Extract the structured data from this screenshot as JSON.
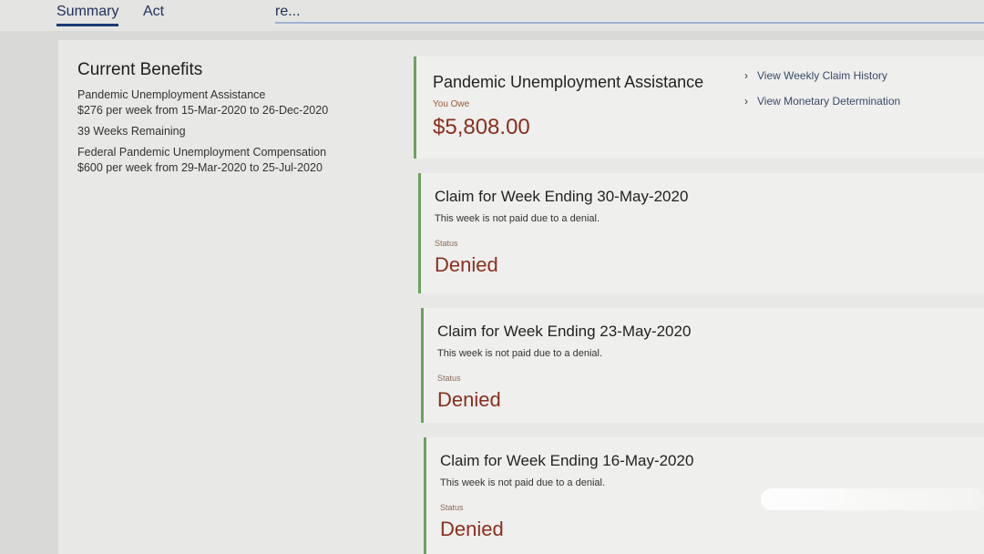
{
  "tabs": {
    "summary": "Summary",
    "activity": "Act",
    "more": "re..."
  },
  "current_benefits": {
    "title": "Current Benefits",
    "lines": [
      "Pandemic Unemployment Assistance",
      "$276 per week from 15-Mar-2020 to 26-Dec-2020",
      "39 Weeks Remaining",
      "Federal Pandemic Unemployment Compensation",
      "$600 per week from 29-Mar-2020 to 25-Jul-2020"
    ]
  },
  "pua": {
    "title": "Pandemic Unemployment Assistance",
    "owe_label": "You Owe",
    "owe_amount": "$5,808.00",
    "links": [
      "View Weekly Claim History",
      "View Monetary Determination"
    ]
  },
  "claims": [
    {
      "title": "Claim for Week Ending 30-May-2020",
      "note": "This week is not paid due to a denial.",
      "status_label": "Status",
      "status": "Denied"
    },
    {
      "title": "Claim for Week Ending 23-May-2020",
      "note": "This week is not paid due to a denial.",
      "status_label": "Status",
      "status": "Denied"
    },
    {
      "title": "Claim for Week Ending 16-May-2020",
      "note": "This week is not paid due to a denial.",
      "status_label": "Status",
      "status": "Denied"
    }
  ],
  "colors": {
    "accent_green": "#6aa35c",
    "status_red": "#8a2f1e",
    "tab_blue": "#1c3c78"
  }
}
